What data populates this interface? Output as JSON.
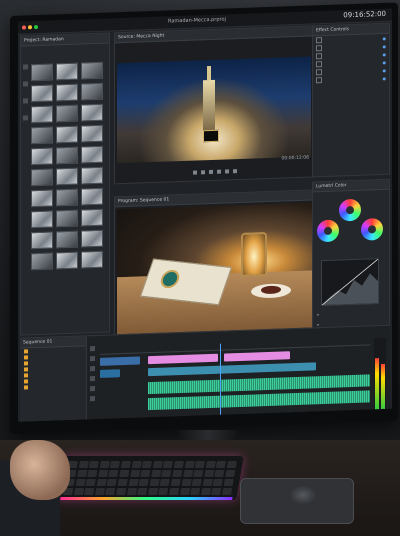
{
  "screen": {
    "window_title": "Ramadan-Mecca.prproj",
    "clock": "09:16:52:00"
  },
  "panels": {
    "project": "Project: Ramadan",
    "source": "Source: Mecca Night",
    "program": "Program: Sequence 01",
    "effects": "Effect Controls",
    "lumetri": "Lumetri Color",
    "timeline": "Sequence 01"
  },
  "source_timecode": "00:00:12:08",
  "colors": {
    "accent": "#4aa3ff",
    "audio_track": "#3ccf9c",
    "video_track": "#e48de3",
    "marker": "#e5a530"
  },
  "icons": [
    "play-icon",
    "stop-icon",
    "step-back-icon",
    "step-forward-icon",
    "razor-icon",
    "selection-icon"
  ]
}
